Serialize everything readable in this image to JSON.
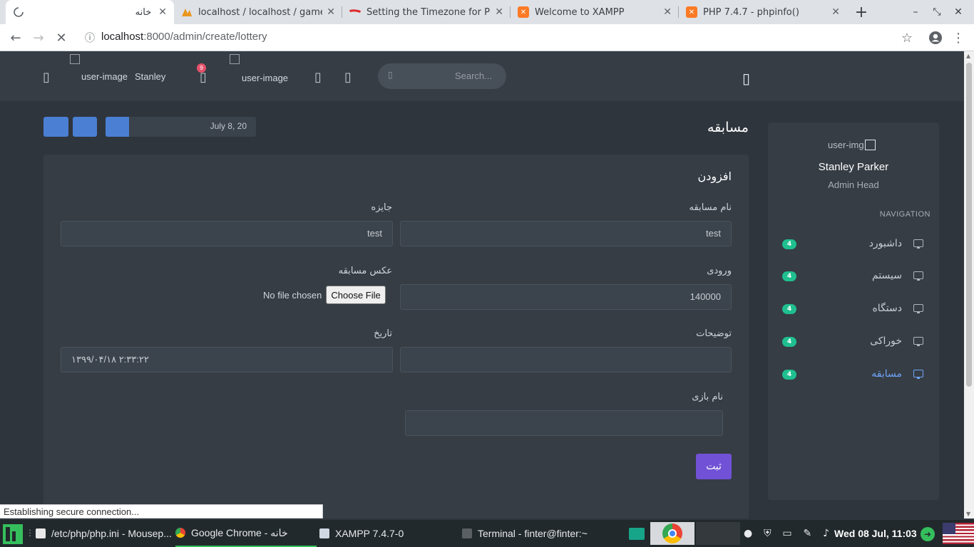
{
  "browser": {
    "tabs": [
      {
        "title": "خانه",
        "favicon": "loading-icon",
        "active": true
      },
      {
        "title": "localhost / localhost / gamen",
        "favicon": "phpmyadmin-icon"
      },
      {
        "title": "Setting the Timezone for PH",
        "favicon": "codeigniter-icon"
      },
      {
        "title": "Welcome to XAMPP",
        "favicon": "xampp-icon"
      },
      {
        "title": "PHP 7.4.7 - phpinfo()",
        "favicon": "xampp-icon"
      }
    ],
    "new_tab": "+",
    "url_host": "localhost",
    "url_path": ":8000/admin/create/lottery",
    "status": "Establishing secure connection..."
  },
  "header": {
    "user_image_alt": "user-image",
    "user_name": "Stanley",
    "notif_count": "9",
    "user_image_alt_2": "user-image",
    "search_placeholder": "Search..."
  },
  "sidebar": {
    "user_img_alt": "user-img",
    "name": "Stanley Parker",
    "role": "Admin Head",
    "nav_label": "NAVIGATION",
    "items": [
      {
        "label": "داشبورد",
        "count": "4"
      },
      {
        "label": "سیستم",
        "count": "4"
      },
      {
        "label": "دستگاه",
        "count": "4"
      },
      {
        "label": "خوراکی",
        "count": "4"
      },
      {
        "label": "مسابقه",
        "count": "4",
        "active": true
      }
    ]
  },
  "page": {
    "title": "مسابقه",
    "date_range": "July 8, 20"
  },
  "form": {
    "title": "افزودن",
    "lottery_name_label": "نام مسابقه",
    "lottery_name_value": "test",
    "prize_label": "جایزه",
    "prize_value": "test",
    "entry_label": "ورودی",
    "entry_value": "140000",
    "image_label": "عکس مسابقه",
    "choose_file": "Choose File",
    "no_file": "No file chosen",
    "description_label": "توضیحات",
    "description_value": "",
    "date_label": "تاریخ",
    "date_value": "۱۳۹۹/۰۴/۱۸ ۲:۳۳:۲۲",
    "game_name_label": "نام بازی",
    "game_name_value": "",
    "submit": "ثبت"
  },
  "taskbar": {
    "items": [
      {
        "label": "/etc/php/php.ini - Mousep..."
      },
      {
        "label": "Google Chrome - خانه",
        "active": true
      },
      {
        "label": "XAMPP 7.4.7-0"
      },
      {
        "label": "Terminal - finter@finter:~"
      }
    ],
    "clock": "Wed 08 Jul, 11:03"
  },
  "colors": {
    "accent": "#4b7fd4",
    "submit": "#7151d6",
    "badge": "#1fbf8f",
    "notif": "#e7506a",
    "active_nav": "#6fa3f7"
  }
}
